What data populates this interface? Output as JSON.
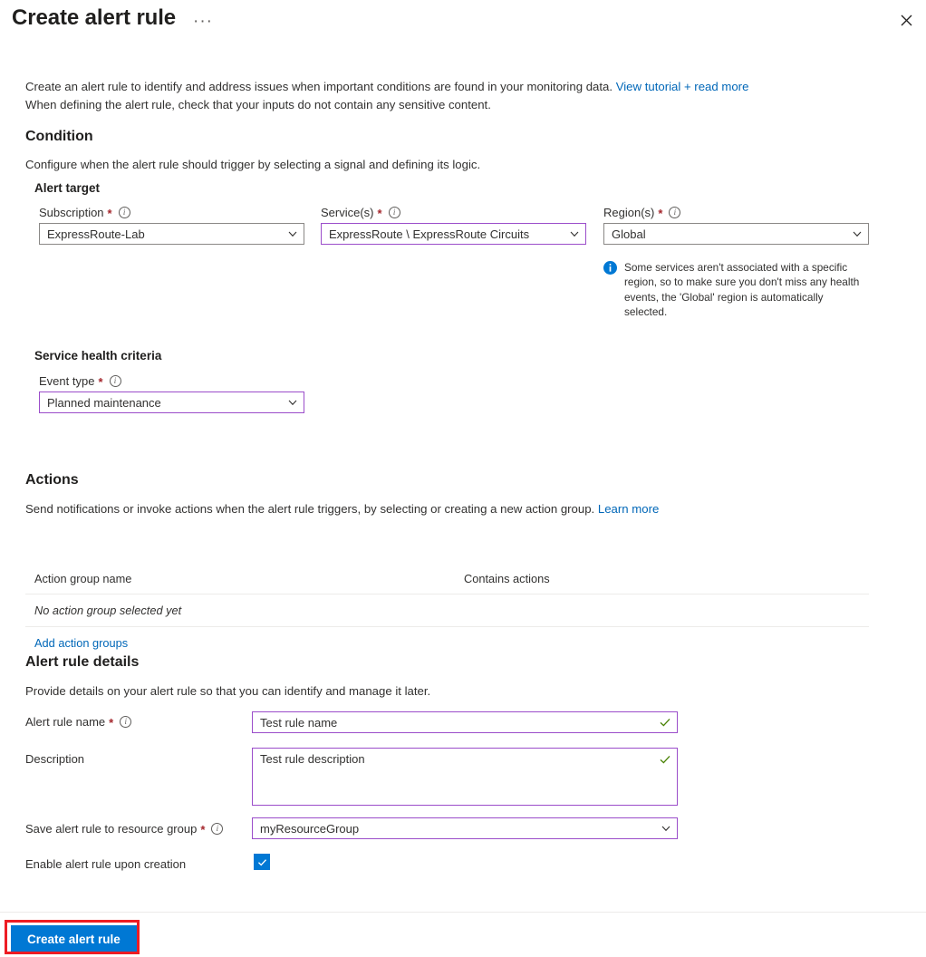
{
  "header": {
    "title": "Create alert rule",
    "ellipsis": "···",
    "close_label": "Close"
  },
  "intro": {
    "line1_before": "Create an alert rule to identify and address issues when important conditions are found in your monitoring data. ",
    "line1_link": "View tutorial + read more",
    "line2": "When defining the alert rule, check that your inputs do not contain any sensitive content."
  },
  "condition": {
    "title": "Condition",
    "description": "Configure when the alert rule should trigger by selecting a signal and defining its logic.",
    "alert_target_title": "Alert target",
    "subscription": {
      "label": "Subscription",
      "required": "*",
      "value": "ExpressRoute-Lab"
    },
    "services": {
      "label": "Service(s)",
      "required": "*",
      "value": "ExpressRoute \\ ExpressRoute Circuits"
    },
    "regions": {
      "label": "Region(s)",
      "required": "*",
      "value": "Global"
    },
    "region_info": "Some services aren't associated with a specific region, so to make sure you don't miss any health events, the 'Global' region is automatically selected.",
    "service_health_criteria_title": "Service health criteria",
    "event_type": {
      "label": "Event type",
      "required": "*",
      "value": "Planned maintenance"
    }
  },
  "actions": {
    "title": "Actions",
    "description_before": "Send notifications or invoke actions when the alert rule triggers, by selecting or creating a new action group. ",
    "description_link": "Learn more",
    "table": {
      "columns": [
        "Action group name",
        "Contains actions"
      ],
      "empty_text": "No action group selected yet"
    },
    "add_link": "Add action groups"
  },
  "alert_rule_details": {
    "title": "Alert rule details",
    "description": "Provide details on your alert rule so that you can identify and manage it later.",
    "rule_name": {
      "label": "Alert rule name",
      "required": "*",
      "value": "Test rule name"
    },
    "rule_description": {
      "label": "Description",
      "value": "Test rule description"
    },
    "resource_group": {
      "label": "Save alert rule to resource group",
      "required": "*",
      "value": "myResourceGroup"
    },
    "enable_checkbox": {
      "label": "Enable alert rule upon creation",
      "checked": true
    }
  },
  "footer": {
    "create_button": "Create alert rule"
  },
  "colors": {
    "accent_blue": "#0078d4",
    "link_blue": "#0067b8",
    "field_accent": "#9b4dca",
    "required_red": "#a4262c",
    "valid_green": "#498205",
    "annotation_red": "#ed1c24"
  }
}
